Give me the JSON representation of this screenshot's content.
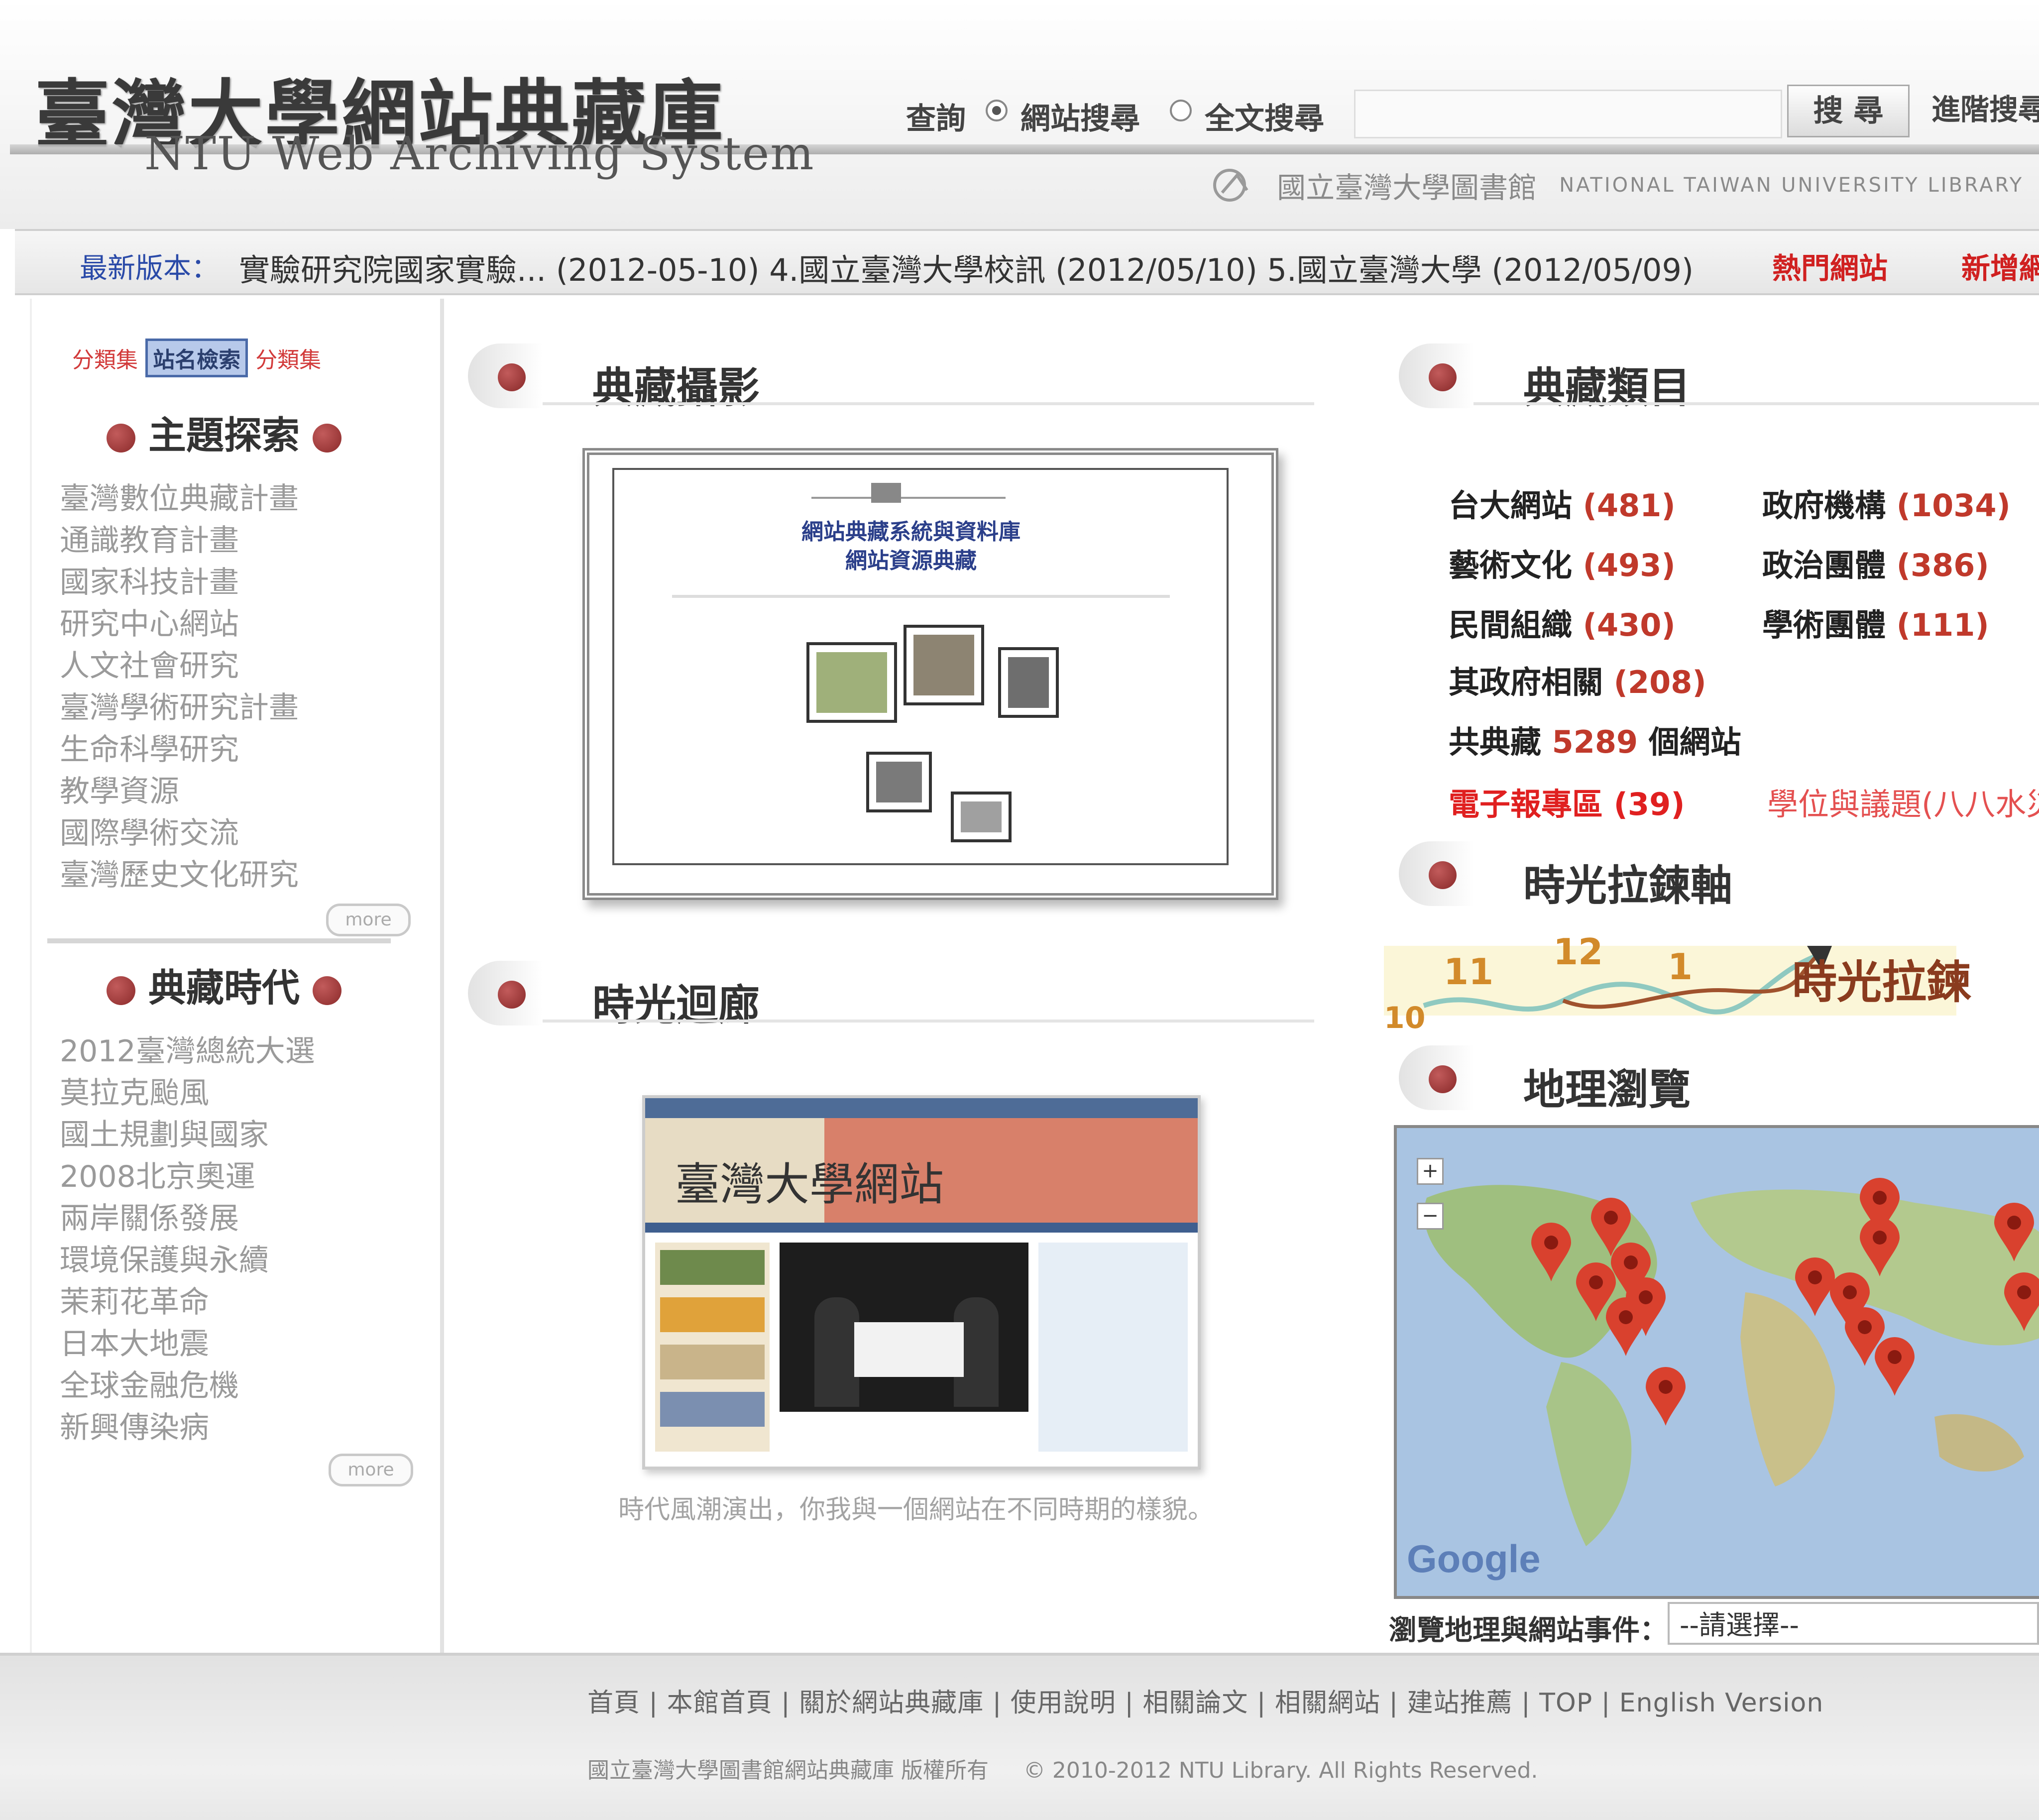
{
  "header": {
    "logo_zh": "臺灣大學網站典藏庫",
    "logo_en": "NTU Web Archiving System",
    "search": {
      "scope_label": "查詢",
      "option_site": "網站搜尋",
      "option_fulltext": "全文搜尋",
      "selected": "網站搜尋",
      "input_value": "",
      "button_label": "搜 尋",
      "advanced_label": "進階搜尋"
    },
    "library_zh": "國立臺灣大學圖書館",
    "library_en": "NATIONAL TAIWAN UNIVERSITY LIBRARY"
  },
  "ticker": {
    "label": "最新版本：",
    "text": "實驗研究院國家實驗... (2012-05-10)  4.國立臺灣大學校訊 (2012/05/10)  5.國立臺灣大學 (2012/05/09)",
    "hot_link": "熱門網站",
    "new_link": "新增網站"
  },
  "sidebar": {
    "tags": [
      "分類集",
      "站名檢索",
      "分類集"
    ],
    "topics": {
      "heading": "主題探索",
      "items": [
        "臺灣數位典藏計畫",
        "通識教育計畫",
        "國家科技計畫",
        "研究中心網站",
        "人文社會研究",
        "臺灣學術研究計畫",
        "生命科學研究",
        "教學資源",
        "國際學術交流",
        "臺灣歷史文化研究"
      ],
      "more": "more"
    },
    "events": {
      "heading": "典藏時代",
      "items": [
        "2012臺灣總統大選",
        "莫拉克颱風",
        "國土規劃與國家",
        "2008北京奧運",
        "兩岸關係發展",
        "環境保護與永續",
        "茉莉花革命",
        "日本大地震",
        "全球金融危機",
        "新興傳染病"
      ],
      "more": "more"
    }
  },
  "sections": {
    "featured": "典藏攝影",
    "collection": "典藏類目",
    "gallery": "時光迴廊",
    "timeline": "時光拉鍊軸",
    "map": "地理瀏覽"
  },
  "featured_page": {
    "title_line1": "網站典藏系統與資料庫",
    "title_line2": "網站資源典藏"
  },
  "collection_stats": {
    "items": [
      {
        "label": "台大網站",
        "count": "(481)"
      },
      {
        "label": "政府機構",
        "count": "(1034)"
      },
      {
        "label": "藝術文化",
        "count": "(493)"
      },
      {
        "label": "政治團體",
        "count": "(386)"
      },
      {
        "label": "民間組織",
        "count": "(430)"
      },
      {
        "label": "學術團體",
        "count": "(111)"
      },
      {
        "label": "其政府相關",
        "count": "(208)"
      }
    ],
    "total_prefix": "共典藏",
    "total_count": "5289",
    "total_suffix": "個網站",
    "ebooks_label": "電子報專區",
    "ebooks_count": "(39)",
    "event_link": "學位與議題(八八水災)"
  },
  "timeline": {
    "labels": [
      "10",
      "11",
      "12",
      "1"
    ],
    "brand": "時光拉鍊"
  },
  "gallery": {
    "caption": "時代風潮演出，你我與一個網站在不同時期的樣貌。",
    "shot_title": "臺灣大學網站"
  },
  "map": {
    "brand": "Google",
    "select_label": "瀏覽地理與網站事件：",
    "select_value": "--請選擇--",
    "zoom_in": "+",
    "zoom_out": "−"
  },
  "footer": {
    "links": [
      "首頁",
      "本館首頁",
      "關於網站典藏庫",
      "使用說明",
      "相關論文",
      "相關網站",
      "建站推薦",
      "TOP",
      "English Version"
    ],
    "copyright_left": "國立臺灣大學圖書館網站典藏庫 版權所有",
    "copyright_right": "© 2010-2012 NTU Library. All Rights Reserved."
  },
  "colors": {
    "accent_red": "#c0392b",
    "link_blue": "#2a4aa8",
    "dot_red": "#9a3232"
  }
}
